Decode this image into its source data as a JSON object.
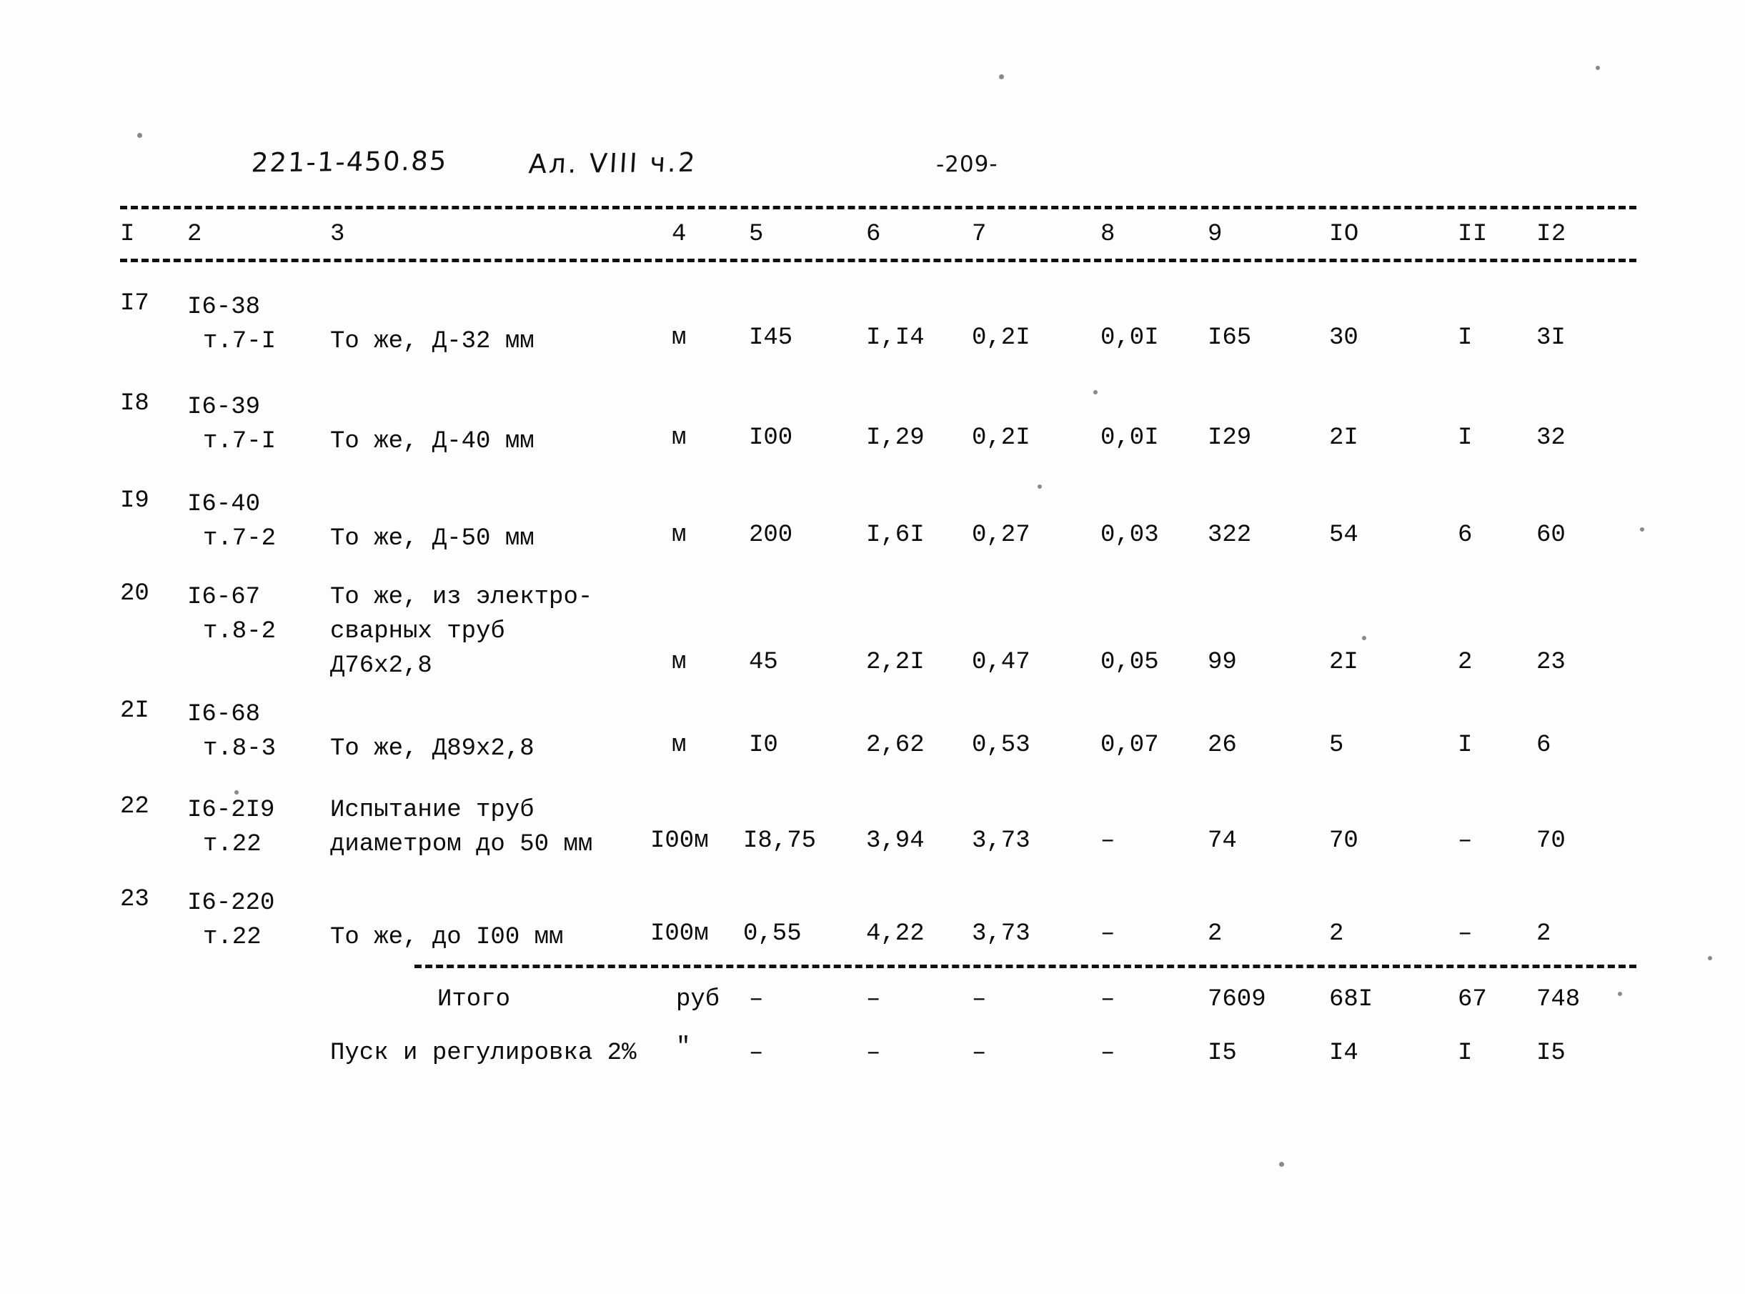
{
  "header": {
    "project_code": "221-1-450.85",
    "album": "Ал. VIII ч.2",
    "page_number": "-209-"
  },
  "table": {
    "column_headers": [
      "I",
      "2",
      "3",
      "4",
      "5",
      "6",
      "7",
      "8",
      "9",
      "IO",
      "II",
      "I2"
    ],
    "rows": [
      {
        "num": "I7",
        "code_line1": "I6-38",
        "code_line2": "т.7-I",
        "description": "То же, Д-32 мм",
        "unit": "м",
        "qty": "I45",
        "c6": "I,I4",
        "c7": "0,2I",
        "c8": "0,0I",
        "c9": "I65",
        "c10": "30",
        "c11": "I",
        "c12": "3I"
      },
      {
        "num": "I8",
        "code_line1": "I6-39",
        "code_line2": "т.7-I",
        "description": "То же, Д-40 мм",
        "unit": "м",
        "qty": "I00",
        "c6": "I,29",
        "c7": "0,2I",
        "c8": "0,0I",
        "c9": "I29",
        "c10": "2I",
        "c11": "I",
        "c12": "32"
      },
      {
        "num": "I9",
        "code_line1": "I6-40",
        "code_line2": "т.7-2",
        "description": "То же, Д-50 мм",
        "unit": "м",
        "qty": "200",
        "c6": "I,6I",
        "c7": "0,27",
        "c8": "0,03",
        "c9": "322",
        "c10": "54",
        "c11": "6",
        "c12": "60"
      },
      {
        "num": "20",
        "code_line1": "I6-67",
        "code_line2": "т.8-2",
        "description": "То же, из электро-\nсварных труб\nД76х2,8",
        "unit": "м",
        "qty": "45",
        "c6": "2,2I",
        "c7": "0,47",
        "c8": "0,05",
        "c9": "99",
        "c10": "2I",
        "c11": "2",
        "c12": "23"
      },
      {
        "num": "2I",
        "code_line1": "I6-68",
        "code_line2": "т.8-3",
        "description": "То же, Д89х2,8",
        "unit": "м",
        "qty": "I0",
        "c6": "2,62",
        "c7": "0,53",
        "c8": "0,07",
        "c9": "26",
        "c10": "5",
        "c11": "I",
        "c12": "6"
      },
      {
        "num": "22",
        "code_line1": "I6-2I9",
        "code_line2": "т.22",
        "description": "Испытание труб\nдиаметром до 50 мм",
        "unit": "I00м",
        "qty": "I8,75",
        "c6": "3,94",
        "c7": "3,73",
        "c8": "–",
        "c9": "74",
        "c10": "70",
        "c11": "–",
        "c12": "70"
      },
      {
        "num": "23",
        "code_line1": "I6-220",
        "code_line2": "т.22",
        "description": "То же, до I00 мм",
        "unit": "I00м",
        "qty": "0,55",
        "c6": "4,22",
        "c7": "3,73",
        "c8": "–",
        "c9": "2",
        "c10": "2",
        "c11": "–",
        "c12": "2"
      }
    ],
    "totals": [
      {
        "label": "Итого",
        "unit": "руб",
        "qty": "–",
        "c6": "–",
        "c7": "–",
        "c8": "–",
        "c9": "7609",
        "c10": "68I",
        "c11": "67",
        "c12": "748"
      },
      {
        "label": "Пуск и регулировка 2%",
        "unit": "\"",
        "qty": "–",
        "c6": "–",
        "c7": "–",
        "c8": "–",
        "c9": "I5",
        "c10": "I4",
        "c11": "I",
        "c12": "I5"
      }
    ]
  }
}
